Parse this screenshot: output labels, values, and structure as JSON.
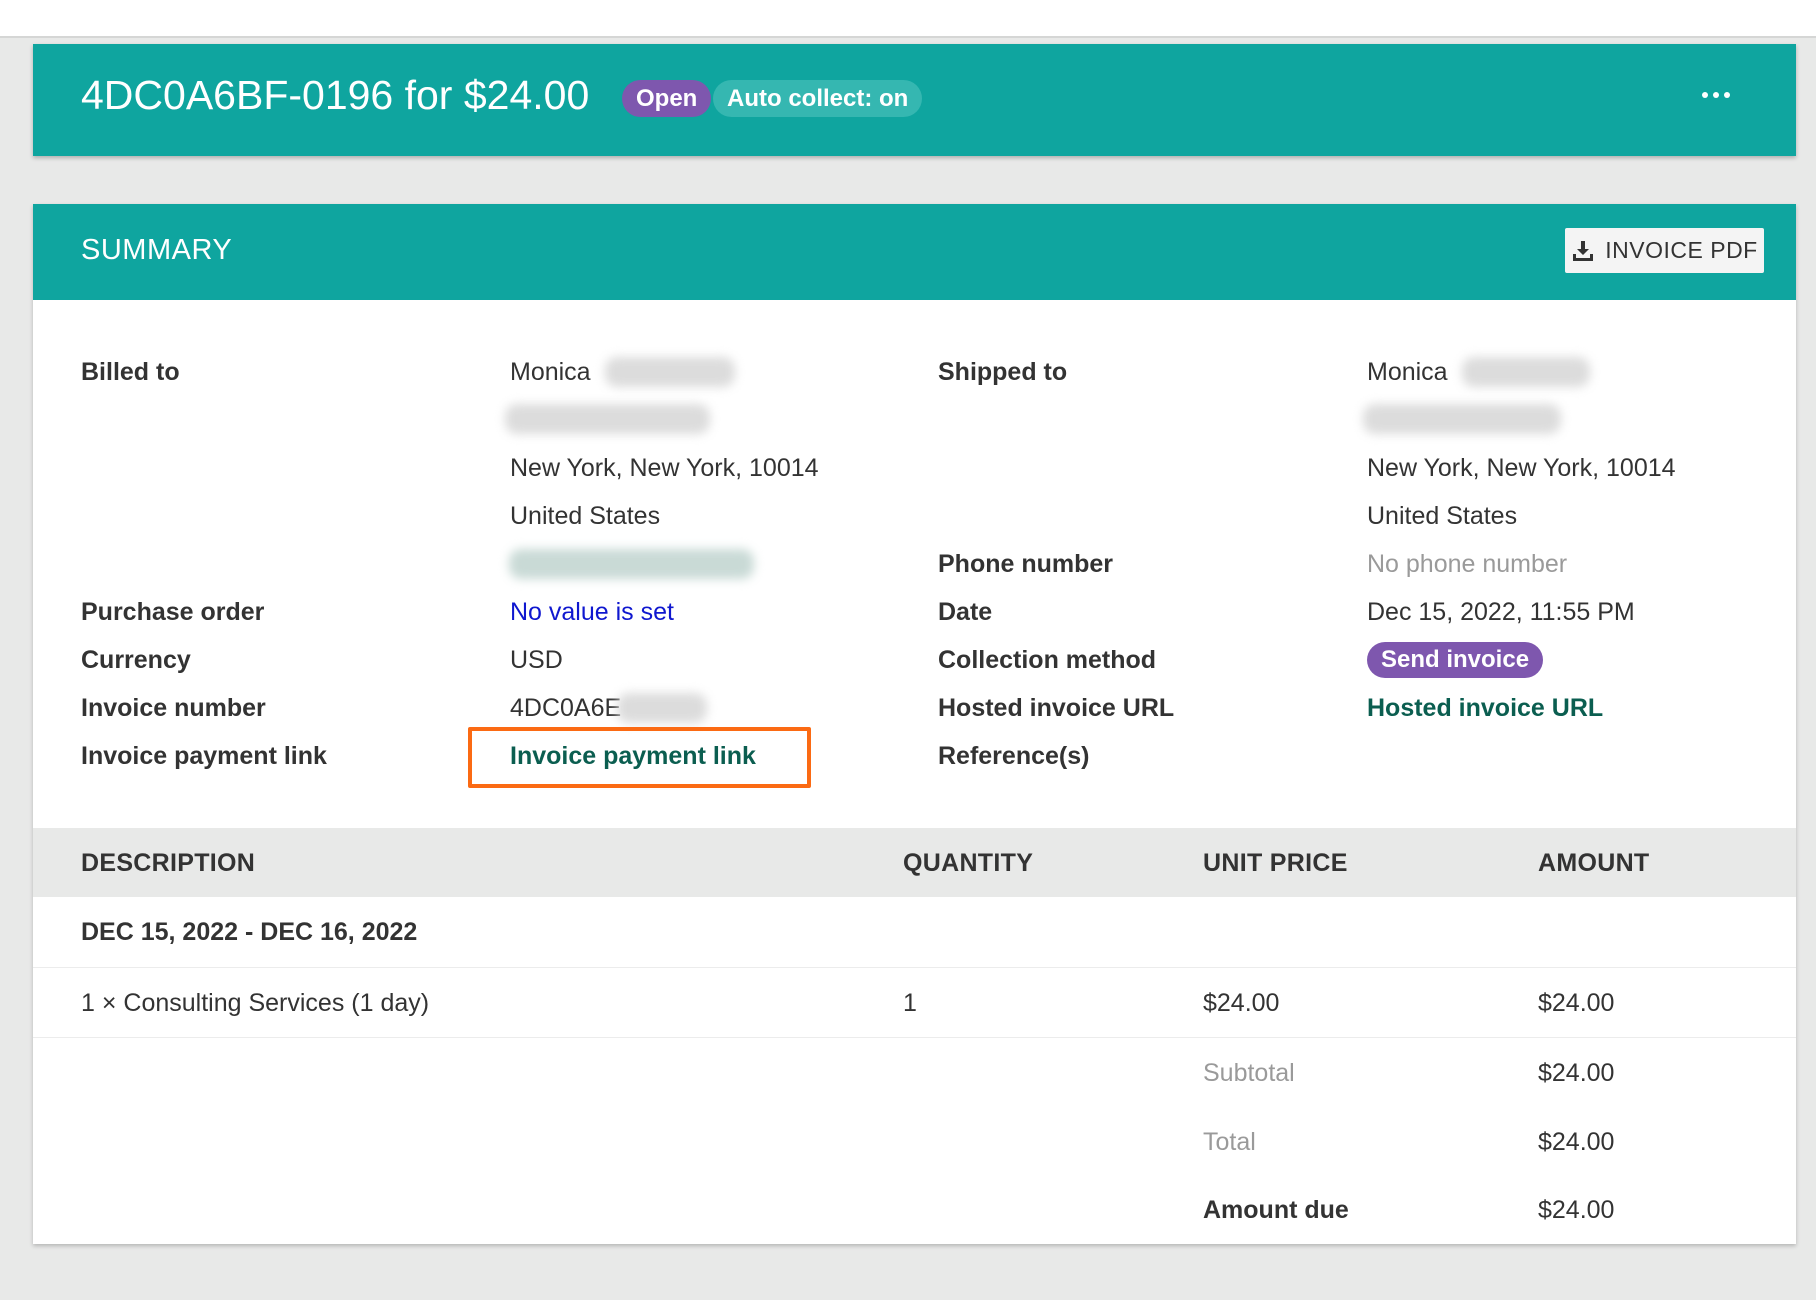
{
  "header": {
    "title": "4DC0A6BF-0196 for $24.00",
    "status_badge": "Open",
    "auto_collect_badge": "Auto collect: on",
    "more_icon": "more-horizontal-icon"
  },
  "summary": {
    "title": "SUMMARY",
    "pdf_button": {
      "icon": "download-icon",
      "label": "INVOICE PDF"
    }
  },
  "billing": {
    "billed_to_label": "Billed to",
    "billed_to_name": "Monica",
    "billed_to_city": "New York, New York, 10014",
    "billed_to_country": "United States",
    "purchase_order_label": "Purchase order",
    "purchase_order_value": "No value is set",
    "currency_label": "Currency",
    "currency_value": "USD",
    "invoice_number_label": "Invoice number",
    "invoice_number_value": "4DC0A6E",
    "payment_link_label": "Invoice payment link",
    "payment_link_value": "Invoice payment link"
  },
  "shipping": {
    "shipped_to_label": "Shipped to",
    "shipped_to_name": "Monica",
    "shipped_to_city": "New York, New York, 10014",
    "shipped_to_country": "United States",
    "phone_label": "Phone number",
    "phone_value": "No phone number",
    "date_label": "Date",
    "date_value": "Dec 15, 2022, 11:55 PM",
    "collection_label": "Collection method",
    "collection_value": "Send invoice",
    "hosted_url_label": "Hosted invoice URL",
    "hosted_url_value": "Hosted invoice URL",
    "references_label": "Reference(s)"
  },
  "table": {
    "columns": [
      "DESCRIPTION",
      "QUANTITY",
      "UNIT PRICE",
      "AMOUNT"
    ],
    "period": "DEC 15, 2022 - DEC 16, 2022",
    "line_items": [
      {
        "description": "1 × Consulting Services (1 day)",
        "quantity": "1",
        "unit_price": "$24.00",
        "amount": "$24.00"
      }
    ],
    "totals": {
      "subtotal_label": "Subtotal",
      "subtotal_value": "$24.00",
      "total_label": "Total",
      "total_value": "$24.00",
      "amount_due_label": "Amount due",
      "amount_due_value": "$24.00"
    }
  },
  "colors": {
    "teal": "#0fa59f",
    "purple": "#7e57ae",
    "link_blue": "#0f17cf",
    "link_teal": "#0b5e50",
    "highlight_orange": "#fb6a13"
  }
}
